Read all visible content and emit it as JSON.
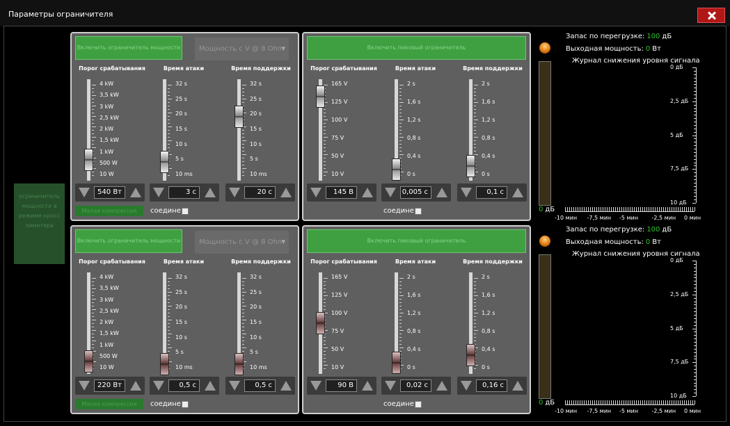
{
  "window": {
    "title": "Параметры ограничителя"
  },
  "side_button": {
    "label": "ограничитель мощности в режиме кросс лимитера"
  },
  "common": {
    "threshold_header": "Порог срабатывания",
    "attack_header": "Время атаки",
    "hold_header": "Время поддержки",
    "link_label": "соедине",
    "power_mode_dropdown": "Мощность с V @ 8 Ohm",
    "power_labels": [
      "4 kW",
      "3,5 kW",
      "3 kW",
      "2,5 kW",
      "2 kW",
      "1,5 kW",
      "1 kW",
      "500 W",
      "10 W"
    ],
    "voltage_labels": [
      "165 V",
      "125 V",
      "100 V",
      "75 V",
      "50 V",
      "10 V"
    ],
    "attack_long_labels": [
      "32 s",
      "25 s",
      "20 s",
      "15 s",
      "10 s",
      "5 s",
      "10 ms"
    ],
    "hold_labels": [
      "32 s",
      "25 s",
      "20 s",
      "15 s",
      "10 s",
      "5 s",
      "10 ms"
    ],
    "attack_short_labels": [
      "2 s",
      "1,6 s",
      "1,2 s",
      "0,8 s",
      "0,4 s",
      "0 s"
    ],
    "hold_short_labels": [
      "2 s",
      "1,6 s",
      "1,2 s",
      "0,8 s",
      "0,4 s",
      "0 s"
    ]
  },
  "panels": [
    {
      "green_label": "Включить ограничитель мощности",
      "compressor_label": "Малая компрессия",
      "threshold": "540 Вт",
      "attack": "3 с",
      "hold": "20 с",
      "threshold_level": 0.17,
      "attack_level": 0.15,
      "hold_level": 0.65
    },
    {
      "green_label": "Включить пиковый ограничитель",
      "threshold": "145 В",
      "attack": "0,005 с",
      "hold": "0,1 с",
      "threshold_level": 0.87,
      "attack_level": 0.06,
      "hold_level": 0.1
    },
    {
      "green_label": "Включить ограничитель мощности",
      "compressor_label": "Малая компрессия",
      "threshold": "220 Вт",
      "attack": "0,5 с",
      "hold": "0,5 с",
      "threshold_level": 0.08,
      "attack_level": 0.05,
      "hold_level": 0.05
    },
    {
      "green_label": "Включить пиковый ограничитель",
      "threshold": "90 В",
      "attack": "0,02 с",
      "hold": "0,16 с",
      "threshold_level": 0.5,
      "attack_level": 0.06,
      "hold_level": 0.15
    }
  ],
  "meters": [
    {
      "margin_label": "Запас по перегрузке:",
      "margin_value": "100",
      "margin_unit": "дБ",
      "output_label": "Выходная мощность:",
      "output_value": "0",
      "output_unit": "Вт",
      "log_title": "Журнал снижения уровня сигнала",
      "db_value": "0",
      "db_unit": "дБ"
    },
    {
      "margin_label": "Запас по перегрузке:",
      "margin_value": "100",
      "margin_unit": "дБ",
      "output_label": "Выходная мощность:",
      "output_value": "0",
      "output_unit": "Вт",
      "log_title": "Журнал снижения уровня сигнала",
      "db_value": "0",
      "db_unit": "дБ"
    }
  ],
  "chart_data": [
    {
      "type": "line",
      "title": "Журнал снижения уровня сигнала",
      "y_ticks": [
        "0 дБ",
        "2,5 дБ",
        "5 дБ",
        "7,5 дБ",
        "10 дБ"
      ],
      "ylim": [
        0,
        10
      ],
      "x_ticks": [
        "-10 мин",
        "-7,5 мин",
        "-5 мин",
        "-2,5 мин",
        "0 мин"
      ],
      "xlim": [
        -10,
        0
      ],
      "series": []
    },
    {
      "type": "line",
      "title": "Журнал снижения уровня сигнала",
      "y_ticks": [
        "0 дБ",
        "2,5 дБ",
        "5 дБ",
        "7,5 дБ",
        "10 дБ"
      ],
      "ylim": [
        0,
        10
      ],
      "x_ticks": [
        "-10 мин",
        "-7,5 мин",
        "-5 мин",
        "-2,5 мин",
        "0 мин"
      ],
      "xlim": [
        -10,
        0
      ],
      "series": []
    }
  ]
}
